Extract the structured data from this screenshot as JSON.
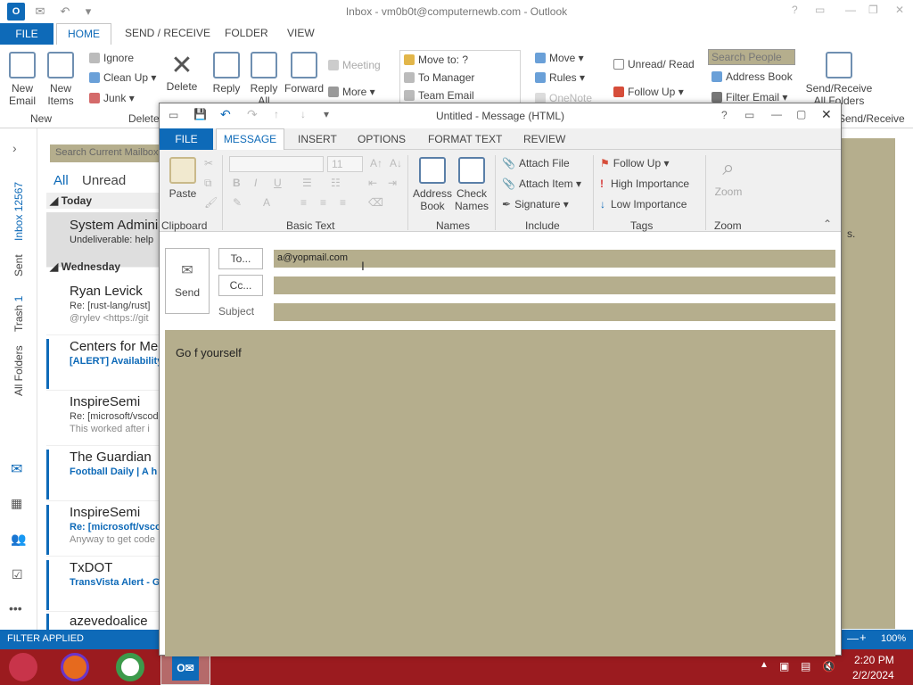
{
  "main_window": {
    "title": "Inbox - vm0b0t@computernewb.com - Outlook",
    "app_icon": "O",
    "tabs": [
      "FILE",
      "HOME",
      "SEND / RECEIVE",
      "FOLDER",
      "VIEW"
    ],
    "ribbon": {
      "new_email": "New\nEmail",
      "new_items": "New\nItems",
      "new_group": "New",
      "ignore": "Ignore",
      "clean_up": "Clean Up",
      "junk": "Junk",
      "delete": "Delete",
      "delete_group": "Delete",
      "reply": "Reply",
      "reply_all": "Reply\nAll",
      "forward": "Forward",
      "meeting": "Meeting",
      "more": "More",
      "move_to": "Move to: ?",
      "to_manager": "To Manager",
      "team_email": "Team Email",
      "move": "Move",
      "rules": "Rules",
      "onenote": "OneNote",
      "unread_read": "Unread/ Read",
      "follow_up": "Follow Up",
      "search_people_placeholder": "Search People",
      "address_book": "Address Book",
      "filter_email": "Filter Email",
      "send_receive": "Send/Receive\nAll Folders",
      "send_receive_group": "Send/Receive"
    }
  },
  "nav": {
    "inbox": "Inbox",
    "inbox_count": "12567",
    "sent": "Sent",
    "trash": "Trash",
    "trash_count": "1",
    "all_folders": "All Folders"
  },
  "mail_list": {
    "search_placeholder": "Search Current Mailbox",
    "filter_all": "All",
    "filter_unread": "Unread",
    "group_today": "Today",
    "group_wednesday": "Wednesday",
    "items": [
      {
        "from": "System Administrator",
        "subject": "Undeliverable: help",
        "preview": ""
      },
      {
        "from": "Ryan Levick",
        "subject": "Re: [rust-lang/rust]",
        "preview": "@rylev <https://git"
      },
      {
        "from": "Centers for Medicare",
        "subject": "[ALERT] Availability",
        "preview": ""
      },
      {
        "from": "InspireSemi",
        "subject": "Re: [microsoft/vscode]",
        "preview": "This worked after i"
      },
      {
        "from": "The Guardian",
        "subject": "Football Daily | A h",
        "preview": ""
      },
      {
        "from": "InspireSemi",
        "subject": "Re: [microsoft/vscode]",
        "preview": "Anyway to get code"
      },
      {
        "from": "TxDOT",
        "subject": "TransVista Alert - G",
        "preview": ""
      },
      {
        "from": "azevedoalice",
        "subject": "",
        "preview": ""
      }
    ]
  },
  "status": {
    "filter": "FILTER APPLIED",
    "zoom": "100%"
  },
  "taskbar": {
    "time": "2:20 PM",
    "date": "2/2/2024"
  },
  "compose": {
    "title": "Untitled - Message (HTML)",
    "tabs": [
      "FILE",
      "MESSAGE",
      "INSERT",
      "OPTIONS",
      "FORMAT TEXT",
      "REVIEW"
    ],
    "ribbon": {
      "paste": "Paste",
      "clipboard": "Clipboard",
      "font_size": "11",
      "basic_text": "Basic Text",
      "address_book": "Address\nBook",
      "check_names": "Check\nNames",
      "names": "Names",
      "attach_file": "Attach File",
      "attach_item": "Attach Item",
      "signature": "Signature",
      "include": "Include",
      "follow_up": "Follow Up",
      "high_importance": "High Importance",
      "low_importance": "Low Importance",
      "tags": "Tags",
      "zoom": "Zoom",
      "zoom_group": "Zoom"
    },
    "send": "Send",
    "to_button": "To...",
    "cc_button": "Cc...",
    "subject_label": "Subject",
    "to_value": "a@yopmail.com",
    "cc_value": "",
    "subject_value": "",
    "body": "Go f yourself"
  },
  "colors": {
    "accent": "#0e6ab8",
    "field_bg": "#b5ae8d",
    "taskbar": "#9b1b1f"
  }
}
